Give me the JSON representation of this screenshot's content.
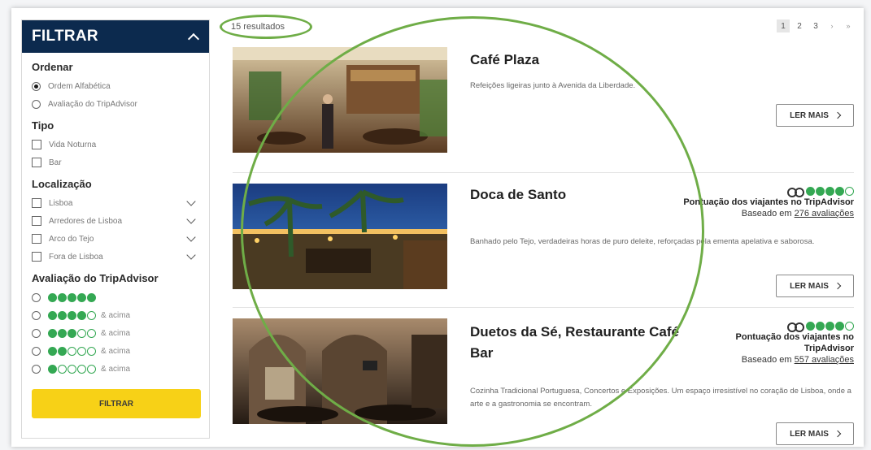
{
  "sidebar": {
    "title": "FILTRAR",
    "sort": {
      "heading": "Ordenar",
      "options": [
        {
          "label": "Ordem Alfabética",
          "selected": true
        },
        {
          "label": "Avaliação do TripAdvisor",
          "selected": false
        }
      ]
    },
    "type": {
      "heading": "Tipo",
      "options": [
        {
          "label": "Vida Noturna"
        },
        {
          "label": "Bar"
        }
      ]
    },
    "location": {
      "heading": "Localização",
      "options": [
        {
          "label": "Lisboa"
        },
        {
          "label": "Arredores de Lisboa"
        },
        {
          "label": "Arco do Tejo"
        },
        {
          "label": "Fora de Lisboa"
        }
      ]
    },
    "rating": {
      "heading": "Avaliação do TripAdvisor",
      "options": [
        {
          "bubbles": 5,
          "suffix": ""
        },
        {
          "bubbles": 4,
          "suffix": "& acima"
        },
        {
          "bubbles": 3,
          "suffix": "& acima"
        },
        {
          "bubbles": 2,
          "suffix": "& acima"
        },
        {
          "bubbles": 1,
          "suffix": "& acima"
        }
      ]
    },
    "filter_button": "FILTRAR"
  },
  "results": {
    "count_label": "15 resultados",
    "pagination": {
      "pages": [
        "1",
        "2",
        "3"
      ],
      "current": "1",
      "next": "›",
      "last": "»"
    },
    "items": [
      {
        "name": "Café Plaza",
        "description": "Refeições ligeiras junto à Avenida da Liberdade.",
        "more_label": "LER MAIS"
      },
      {
        "name": "Doca de Santo",
        "rating_bubbles": 4.5,
        "rating_label": "Pontuação dos viajantes no TripAdvisor",
        "reviews_prefix": "Baseado em",
        "reviews_link": "276 avaliações",
        "description": "Banhado pelo Tejo, verdadeiras horas de puro deleite, reforçadas pela ementa apelativa e saborosa.",
        "more_label": "LER MAIS"
      },
      {
        "name": "Duetos da Sé, Restaurante Café Bar",
        "rating_bubbles": 4.5,
        "rating_label_line1": "Pontuação dos viajantes no",
        "rating_label_line2": "TripAdvisor",
        "reviews_prefix": "Baseado em",
        "reviews_link": "557 avaliações",
        "description": "Cozinha Tradicional Portuguesa, Concertos e Exposições. Um espaço irresistível no coração de Lisboa, onde a arte e a gastronomia se encontram.",
        "more_label": "LER MAIS"
      }
    ]
  },
  "colors": {
    "header_bg": "#0c2a4e",
    "accent_yellow": "#f7d117",
    "tripadvisor_green": "#34a853",
    "annotation_green": "#6fad47"
  }
}
